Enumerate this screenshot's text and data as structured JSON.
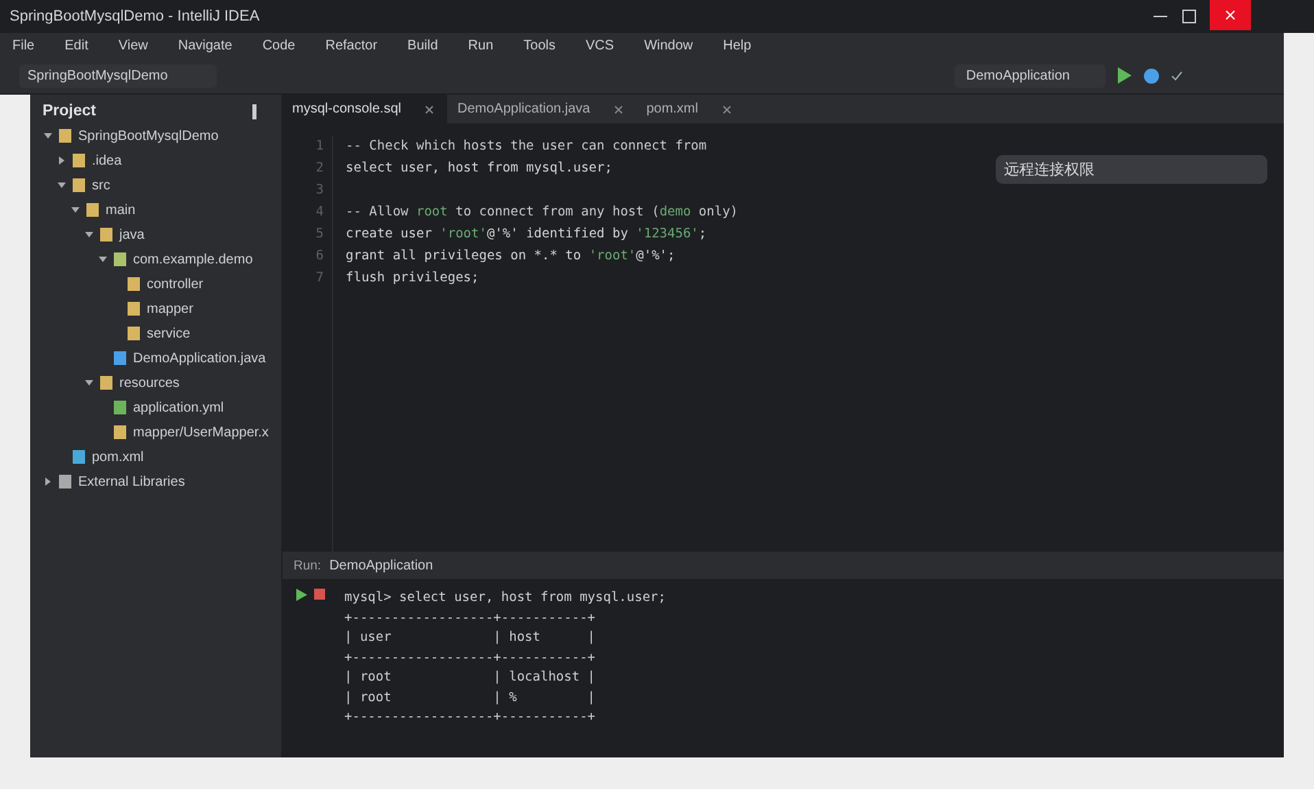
{
  "window": {
    "title": "SpringBootMysqlDemo - IntelliJ IDEA"
  },
  "menu": [
    "File",
    "Edit",
    "View",
    "Navigate",
    "Code",
    "Refactor",
    "Build",
    "Run",
    "Tools",
    "VCS",
    "Window",
    "Help"
  ],
  "toolbar": {
    "project": "SpringBootMysqlDemo",
    "run_config": "DemoApplication"
  },
  "project_panel": {
    "title": "Project",
    "tree": [
      {
        "label": "SpringBootMysqlDemo",
        "color": "#d7b45f",
        "expanded": true,
        "children": [
          {
            "label": ".idea",
            "color": "#d7b45f",
            "expanded": false
          },
          {
            "label": "src",
            "color": "#d7b45f",
            "expanded": true,
            "children": [
              {
                "label": "main",
                "color": "#d7b45f",
                "expanded": true,
                "children": [
                  {
                    "label": "java",
                    "color": "#d7b45f",
                    "expanded": true,
                    "children": [
                      {
                        "label": "com.example.demo",
                        "color": "#a9c26b",
                        "expanded": true,
                        "children": [
                          {
                            "label": "controller",
                            "color": "#d7b45f"
                          },
                          {
                            "label": "mapper",
                            "color": "#d7b45f"
                          },
                          {
                            "label": "service",
                            "color": "#d7b45f"
                          }
                        ]
                      },
                      {
                        "label": "DemoApplication.java",
                        "color": "#4a9fe8"
                      }
                    ]
                  },
                  {
                    "label": "resources",
                    "color": "#d7b45f",
                    "expanded": true,
                    "children": [
                      {
                        "label": "application.yml",
                        "color": "#6cb35c"
                      },
                      {
                        "label": "mapper/UserMapper.x",
                        "color": "#d7b45f"
                      }
                    ]
                  }
                ]
              }
            ]
          },
          {
            "label": "pom.xml",
            "color": "#4aa8d8"
          }
        ]
      },
      {
        "label": "External Libraries",
        "color": "#a8a8a8",
        "expanded": false
      }
    ]
  },
  "tabs": [
    {
      "label": "mysql-console.sql",
      "selected": true
    },
    {
      "label": "DemoApplication.java",
      "selected": false
    },
    {
      "label": "pom.xml",
      "selected": false
    }
  ],
  "editor": {
    "lines": [
      {
        "number": "1",
        "segments": [
          {
            "kind": "comment",
            "text": "-- Check which hosts the user can connect from"
          }
        ]
      },
      {
        "number": "2",
        "segments": [
          {
            "kind": "plain",
            "text": "select user, host from mysql.user;"
          }
        ]
      },
      {
        "number": "3"
      },
      {
        "number": "4",
        "segments": [
          {
            "kind": "comment",
            "text": "-- Allow "
          },
          {
            "kind": "string",
            "text": "root"
          },
          {
            "kind": "comment",
            "text": " to connect from any host ("
          },
          {
            "kind": "string",
            "text": "demo"
          },
          {
            "kind": "comment",
            "text": " only)"
          }
        ]
      },
      {
        "number": "5",
        "segments": [
          {
            "kind": "plain",
            "text": "create user "
          },
          {
            "kind": "string",
            "text": "'root'"
          },
          {
            "kind": "plain",
            "text": "@'%' identified by "
          },
          {
            "kind": "string",
            "text": "'123456'"
          },
          {
            "kind": "plain",
            "text": ";"
          }
        ]
      },
      {
        "number": "6",
        "segments": [
          {
            "kind": "plain",
            "text": "grant all privileges on *.* to "
          },
          {
            "kind": "string",
            "text": "'root'"
          },
          {
            "kind": "plain",
            "text": "@'%';"
          }
        ]
      },
      {
        "number": "7",
        "segments": [
          {
            "kind": "plain",
            "text": "flush privileges;"
          }
        ]
      }
    ],
    "floating_label": "远程连接权限"
  },
  "run_panel": {
    "label": "Run:",
    "config": "DemoApplication",
    "output": [
      "mysql> select user, host from mysql.user;",
      "+------------------+-----------+",
      "| user             | host      |",
      "+------------------+-----------+",
      "| root             | localhost |",
      "| root             | %         |",
      "+------------------+-----------+"
    ]
  }
}
